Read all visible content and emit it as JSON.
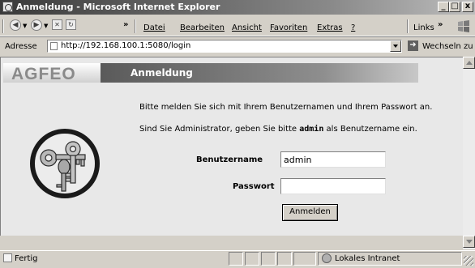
{
  "window": {
    "title": "Anmeldung - Microsoft Internet Explorer"
  },
  "window_buttons": {
    "minimize": "_",
    "maximize": "□",
    "close": "x"
  },
  "toolbar": {
    "back_icon": "back-icon",
    "forward_icon": "forward-icon",
    "more": "»"
  },
  "menu": {
    "file": "Datei",
    "edit": "Bearbeiten",
    "view": "Ansicht",
    "favorites": "Favoriten",
    "tools": "Extras",
    "help": "?"
  },
  "links": {
    "label": "Links",
    "more": "»"
  },
  "address": {
    "label": "Adresse",
    "url": "http://192.168.100.1:5080/login",
    "go_label": "Wechseln zu"
  },
  "page": {
    "logo": "AGFEO",
    "header": "Anmeldung",
    "instruction": "Bitte melden Sie sich mit Ihrem Benutzernamen und Ihrem Passwort an.",
    "admin_prefix": "Sind Sie Administrator, geben Sie bitte ",
    "admin_word": "admin",
    "admin_suffix": " als Benutzername ein.",
    "username_label": "Benutzername",
    "username_value": "admin",
    "password_label": "Passwort",
    "password_value": "",
    "login_button": "Anmelden"
  },
  "status": {
    "text": "Fertig",
    "zone": "Lokales Intranet"
  }
}
